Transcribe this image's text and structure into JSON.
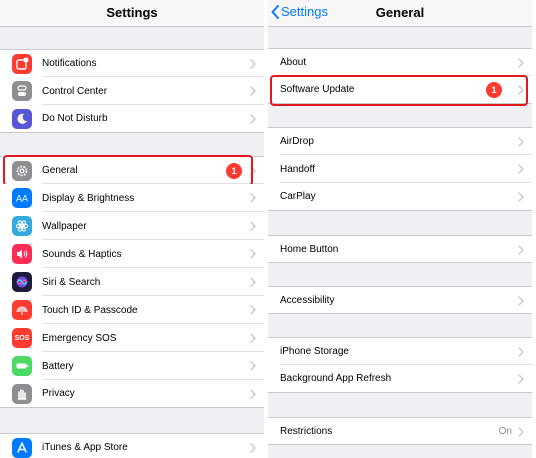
{
  "colors": {
    "ios_blue": "#007aff",
    "chevron_gray": "#c7c7cc",
    "badge_red": "#ff3b30",
    "highlight_red": "#e0181f",
    "group_bg": "#efeff4"
  },
  "left_panel": {
    "title": "Settings",
    "groups": [
      [
        {
          "label": "Notifications",
          "icon": "notifications-icon",
          "icon_color": "#ff3b30"
        },
        {
          "label": "Control Center",
          "icon": "control-center-icon",
          "icon_color": "#8e8e93"
        },
        {
          "label": "Do Not Disturb",
          "icon": "moon-icon",
          "icon_color": "#5856d6"
        }
      ],
      [
        {
          "label": "General",
          "icon": "gear-icon",
          "icon_color": "#8e8e93",
          "badge": "1",
          "highlighted": true
        },
        {
          "label": "Display & Brightness",
          "icon": "display-brightness-icon",
          "icon_color": "#007aff"
        },
        {
          "label": "Wallpaper",
          "icon": "wallpaper-icon",
          "icon_color": "#34aadc"
        },
        {
          "label": "Sounds & Haptics",
          "icon": "speaker-icon",
          "icon_color": "#ff2d55"
        },
        {
          "label": "Siri & Search",
          "icon": "siri-icon",
          "icon_color": "#1c1c3c"
        },
        {
          "label": "Touch ID & Passcode",
          "icon": "fingerprint-icon",
          "icon_color": "#ff3b30"
        },
        {
          "label": "Emergency SOS",
          "icon": "sos-icon",
          "icon_color": "#ff3b30",
          "icon_text": "SOS"
        },
        {
          "label": "Battery",
          "icon": "battery-icon",
          "icon_color": "#4cd964"
        },
        {
          "label": "Privacy",
          "icon": "hand-icon",
          "icon_color": "#8e8e93"
        }
      ],
      [
        {
          "label": "iTunes & App Store",
          "icon": "app-store-icon",
          "icon_color": "#007aff"
        }
      ]
    ]
  },
  "right_panel": {
    "title": "General",
    "back_label": "Settings",
    "groups": [
      [
        {
          "label": "About"
        },
        {
          "label": "Software Update",
          "badge": "1",
          "highlighted": true
        }
      ],
      [
        {
          "label": "AirDrop"
        },
        {
          "label": "Handoff"
        },
        {
          "label": "CarPlay"
        }
      ],
      [
        {
          "label": "Home Button"
        }
      ],
      [
        {
          "label": "Accessibility"
        }
      ],
      [
        {
          "label": "iPhone Storage"
        },
        {
          "label": "Background App Refresh"
        }
      ],
      [
        {
          "label": "Restrictions",
          "value": "On"
        }
      ]
    ]
  }
}
